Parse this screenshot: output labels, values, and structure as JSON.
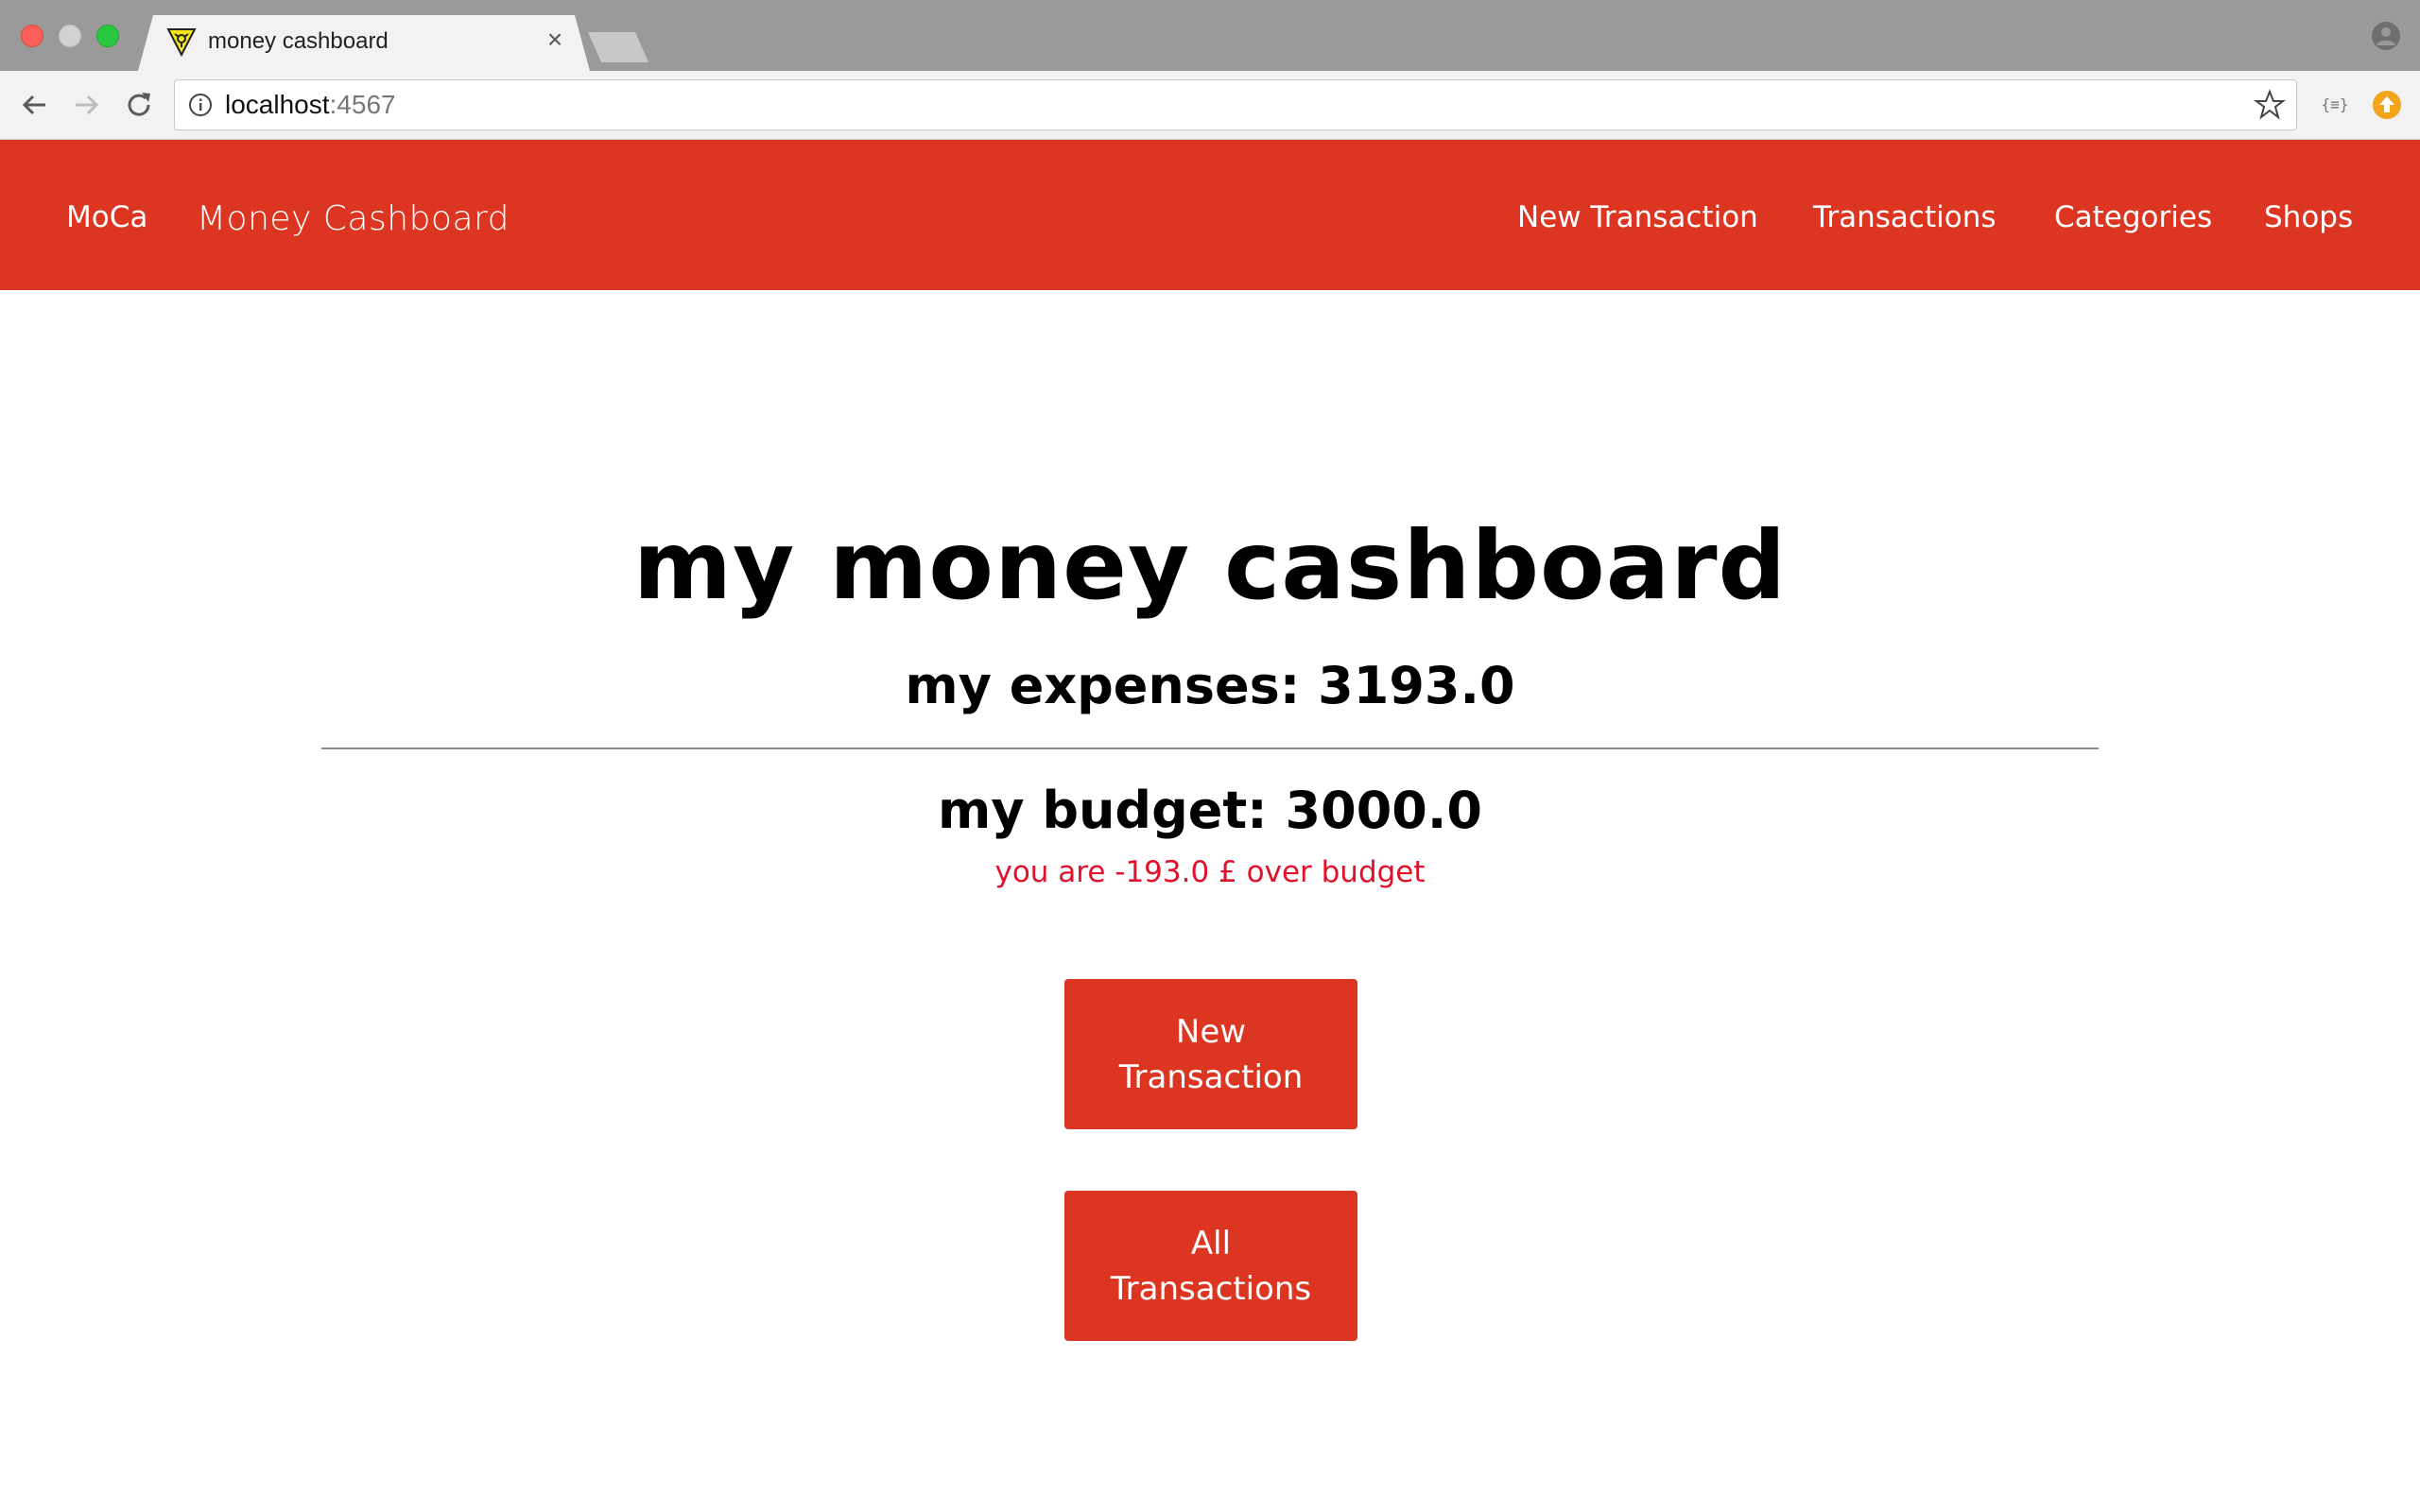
{
  "browser": {
    "tab_title": "money cashboard",
    "tab_close": "×",
    "url_host": "localhost",
    "url_port": ":4567",
    "extension_label": "{≡}"
  },
  "navbar": {
    "brand": "MoCa",
    "subtitle": "Money Cashboard",
    "links": [
      "New Transaction",
      "Transactions",
      "Categories",
      "Shops"
    ],
    "background_color": "#dc3622"
  },
  "main": {
    "title": "my money cashboard",
    "expenses": "my expenses: 3193.0",
    "budget": "my budget: 3000.0",
    "warning": "you are -193.0 £ over budget",
    "warning_color": "#e0112b",
    "buttons": {
      "new_transaction": "New Transaction",
      "all_transactions": "All Transactions"
    }
  }
}
